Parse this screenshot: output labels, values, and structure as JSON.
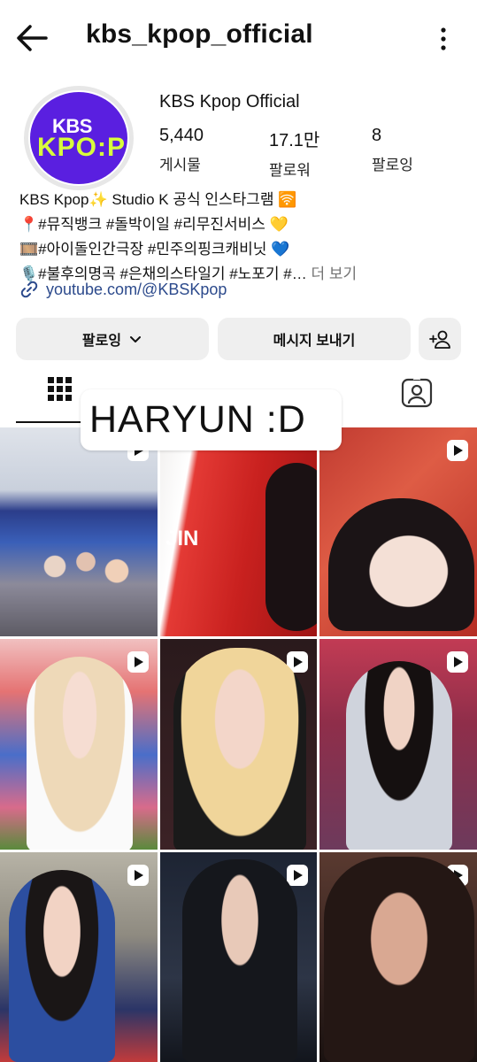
{
  "header": {
    "username": "kbs_kpop_official",
    "back_icon": "arrow-left-icon",
    "menu_icon": "more-vertical-icon"
  },
  "profile": {
    "avatar_logo_top": "KBS",
    "avatar_logo_bottom": "KPO:P",
    "display_name": "KBS Kpop Official",
    "stats": [
      {
        "value": "5,440",
        "label": "게시물"
      },
      {
        "value": "17.1만",
        "label": "팔로워"
      },
      {
        "value": "8",
        "label": "팔로잉"
      }
    ]
  },
  "bio": {
    "line1": "KBS Kpop✨ Studio K 공식 인스타그램 🛜",
    "line2": "📍#뮤직뱅크 #돌박이일 #리무진서비스 💛",
    "line3": "🎞️#아이돌인간극장 #민주의핑크캐비닛 💙",
    "line4": "🎙️#불후의명곡 #은채의스타일기 #노포기 #…",
    "more_label": "더 보기",
    "link_text": "youtube.com/@KBSKpop"
  },
  "actions": {
    "follow_label": "팔로잉",
    "message_label": "메시지 보내기"
  },
  "overlay_text": "HARYUN :D",
  "grid": {
    "tiles": [
      {
        "label": "",
        "video": true
      },
      {
        "label": "JIN",
        "video": false
      },
      {
        "label": "",
        "video": true
      },
      {
        "label": "",
        "video": true
      },
      {
        "label": "",
        "video": true
      },
      {
        "label": "",
        "video": true
      },
      {
        "label": "",
        "video": true
      },
      {
        "label": "",
        "video": true
      },
      {
        "label": "",
        "video": true
      }
    ]
  },
  "colors": {
    "brand_purple": "#5a1fe0",
    "brand_lime": "#d8ff3b",
    "link_blue": "#2c4a8c",
    "button_gray": "#efefef"
  }
}
